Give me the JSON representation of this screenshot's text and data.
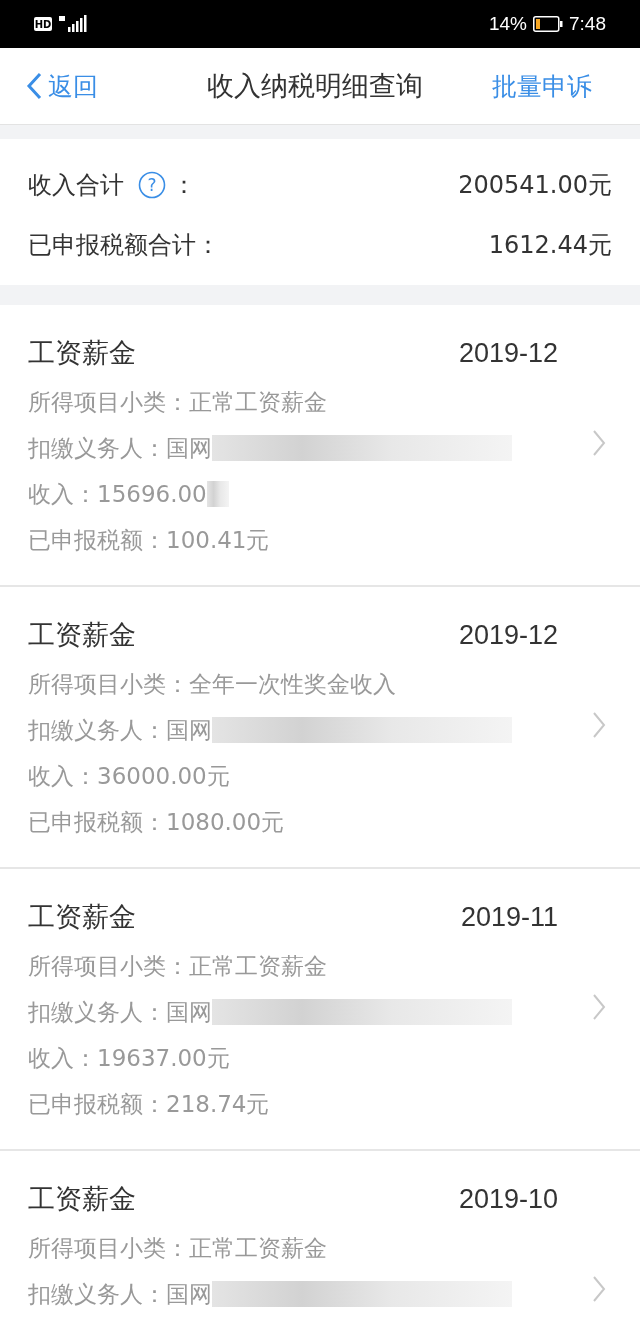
{
  "status_bar": {
    "hd_badge": "HD",
    "battery_percent": "14%",
    "time": "7:48"
  },
  "nav": {
    "back": "返回",
    "title": "收入纳税明细查询",
    "action": "批量申诉"
  },
  "summary": {
    "income_label": "收入合计",
    "help_icon": "?",
    "income_colon": "：",
    "income_value": "200541.00元",
    "tax_label": "已申报税额合计：",
    "tax_value": "1612.44元"
  },
  "records": [
    {
      "category": "工资薪金",
      "date": "2019-12",
      "subcategory": "所得项目小类：正常工资薪金",
      "withholder": "扣缴义务人：国网",
      "withholder_redacted": true,
      "income": "收入：15696.00",
      "income_redacted": true,
      "tax": "已申报税额：100.41元"
    },
    {
      "category": "工资薪金",
      "date": "2019-12",
      "subcategory": "所得项目小类：全年一次性奖金收入",
      "withholder": "扣缴义务人：国网",
      "withholder_redacted": true,
      "income": "收入：36000.00元",
      "income_redacted": false,
      "tax": "已申报税额：1080.00元"
    },
    {
      "category": "工资薪金",
      "date": "2019-11",
      "subcategory": "所得项目小类：正常工资薪金",
      "withholder": "扣缴义务人：国网",
      "withholder_redacted": true,
      "income": "收入：19637.00元",
      "income_redacted": false,
      "tax": "已申报税额：218.74元"
    },
    {
      "category": "工资薪金",
      "date": "2019-10",
      "subcategory": "所得项目小类：正常工资薪金",
      "withholder": "扣缴义务人：国网",
      "withholder_redacted": true
    }
  ]
}
